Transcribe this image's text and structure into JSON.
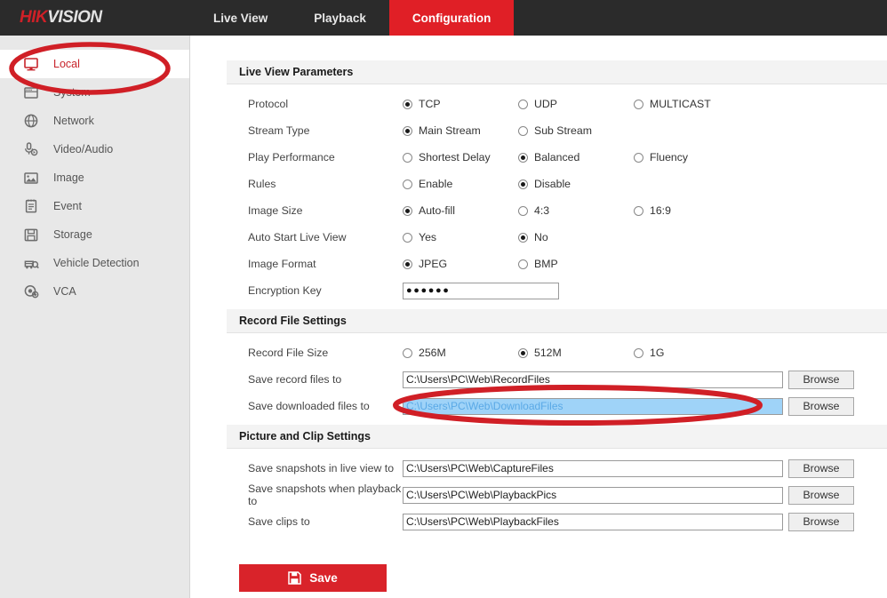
{
  "brand": {
    "part1": "HIK",
    "part2": "VISION"
  },
  "nav": [
    {
      "label": "Live View",
      "active": false
    },
    {
      "label": "Playback",
      "active": false
    },
    {
      "label": "Configuration",
      "active": true
    }
  ],
  "sidebar": {
    "items": [
      {
        "label": "Local",
        "icon": "monitor-icon",
        "active": true
      },
      {
        "label": "System",
        "icon": "system-icon",
        "active": false
      },
      {
        "label": "Network",
        "icon": "globe-icon",
        "active": false
      },
      {
        "label": "Video/Audio",
        "icon": "microphone-icon",
        "active": false
      },
      {
        "label": "Image",
        "icon": "picture-icon",
        "active": false
      },
      {
        "label": "Event",
        "icon": "clipboard-icon",
        "active": false
      },
      {
        "label": "Storage",
        "icon": "floppy-disk-icon",
        "active": false
      },
      {
        "label": "Vehicle Detection",
        "icon": "vehicle-search-icon",
        "active": false
      },
      {
        "label": "VCA",
        "icon": "vca-icon",
        "active": false
      }
    ]
  },
  "sections": {
    "live_view": {
      "title": "Live View Parameters",
      "rows": {
        "protocol": {
          "label": "Protocol",
          "options": [
            "TCP",
            "UDP",
            "MULTICAST"
          ],
          "selected": 0
        },
        "stream": {
          "label": "Stream Type",
          "options": [
            "Main Stream",
            "Sub Stream"
          ],
          "selected": 0
        },
        "play_perf": {
          "label": "Play Performance",
          "options": [
            "Shortest Delay",
            "Balanced",
            "Fluency"
          ],
          "selected": 1
        },
        "rules": {
          "label": "Rules",
          "options": [
            "Enable",
            "Disable"
          ],
          "selected": 1
        },
        "img_size": {
          "label": "Image Size",
          "options": [
            "Auto-fill",
            "4:3",
            "16:9"
          ],
          "selected": 0
        },
        "autostart": {
          "label": "Auto Start Live View",
          "options": [
            "Yes",
            "No"
          ],
          "selected": 1
        },
        "img_fmt": {
          "label": "Image Format",
          "options": [
            "JPEG",
            "BMP"
          ],
          "selected": 0
        },
        "enc_key": {
          "label": "Encryption Key",
          "value": "●●●●●●"
        }
      }
    },
    "record_file": {
      "title": "Record File Settings",
      "size_row": {
        "label": "Record File Size",
        "options": [
          "256M",
          "512M",
          "1G"
        ],
        "selected": 1
      },
      "paths": [
        {
          "label": "Save record files to",
          "value": "C:\\Users\\PC\\Web\\RecordFiles",
          "browse": "Browse",
          "selected": false
        },
        {
          "label": "Save downloaded files to",
          "value": "C:\\Users\\PC\\Web\\DownloadFiles",
          "browse": "Browse",
          "selected": true
        }
      ]
    },
    "picture_clip": {
      "title": "Picture and Clip Settings",
      "paths": [
        {
          "label": "Save snapshots in live view to",
          "value": "C:\\Users\\PC\\Web\\CaptureFiles",
          "browse": "Browse",
          "selected": false
        },
        {
          "label": "Save snapshots when playback to",
          "value": "C:\\Users\\PC\\Web\\PlaybackPics",
          "browse": "Browse",
          "selected": false
        },
        {
          "label": "Save clips to",
          "value": "C:\\Users\\PC\\Web\\PlaybackFiles",
          "browse": "Browse",
          "selected": false
        }
      ]
    }
  },
  "save_button": {
    "label": "Save",
    "icon": "floppy-disk-icon"
  },
  "annotations": {
    "color": "#d01f26",
    "marks": [
      {
        "name": "ellipse-around-local-menu-item"
      },
      {
        "name": "ellipse-around-download-path-field"
      }
    ]
  },
  "colors": {
    "brand_red": "#e01f26",
    "topbar_bg": "#2b2b2b",
    "sidebar_bg": "#e8e8e8",
    "selection_blue": "#9fd3f8",
    "annotation_red": "#d01f26"
  }
}
